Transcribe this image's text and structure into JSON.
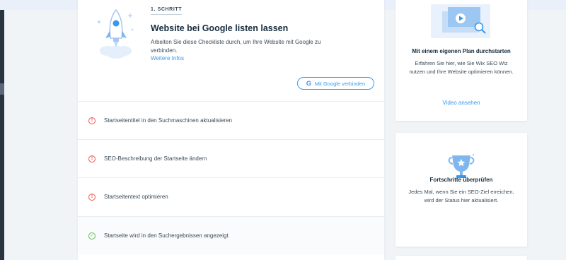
{
  "step": {
    "label": "1. SCHRITT",
    "title": "Website bei Google listen lassen",
    "description": "Arbeiten Sie diese Checkliste durch, um Ihre Website mit Google zu verbinden.",
    "more_link": "Weitere Infos",
    "connect_button": "Mit Google verbinden",
    "connect_icon": "google-g-logo"
  },
  "tasks": [
    {
      "label": "Startseitentitel in den Suchmaschinen aktualisieren",
      "status": "warning",
      "icon": "!"
    },
    {
      "label": "SEO-Beschreibung der Startseite ändern",
      "status": "warning",
      "icon": "!"
    },
    {
      "label": "Startseitentext optimieren",
      "status": "warning",
      "icon": "!"
    },
    {
      "label": "Startseite wird in den Suchergebnissen angezeigt",
      "status": "done",
      "icon": "✓"
    }
  ],
  "plan_card": {
    "title": "Mit einem eigenen Plan durchstarten",
    "description": "Erfahren Sie hier, wie Sie Wix SEO Wiz nutzen und Ihre Website optimieren können.",
    "link": "Video ansehen"
  },
  "progress_card": {
    "title": "Fortschritte überprüfen",
    "description": "Jedes Mal, wenn Sie ein SEO-Ziel erreichen, wird der Status hier aktualisiert."
  },
  "colors": {
    "accent_blue": "#3899ec",
    "warning_red": "#ee5951",
    "success_green": "#60bc57",
    "page_bg": "#f0f4f7",
    "heading": "#162d3d",
    "body_text": "#3b4a57"
  }
}
